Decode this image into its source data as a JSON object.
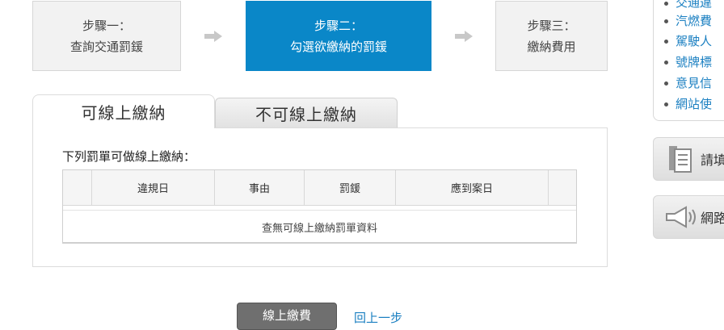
{
  "steps": [
    {
      "title": "步驟一：",
      "text": "查詢交通罰鍰",
      "active": false
    },
    {
      "title": "步驟二：",
      "text": "勾選欲繳納的罰鍰",
      "active": true
    },
    {
      "title": "步驟三：",
      "text": "繳納費用",
      "active": false
    }
  ],
  "tabs": {
    "online": "可線上繳納",
    "offline": "不可線上繳納"
  },
  "table": {
    "title": "下列罰單可做線上繳納：",
    "headers": [
      "",
      "違規日",
      "事由",
      "罰鍰",
      "應到案日",
      ""
    ],
    "empty_message": "查無可線上繳納罰單資料"
  },
  "actions": {
    "pay_label": "線上繳費",
    "back_label": "回上一步"
  },
  "sidebar": {
    "links": [
      "交通違",
      "汽燃費",
      "駕駛人",
      "號牌標",
      "意見信",
      "網站使"
    ],
    "buttons": [
      {
        "label": "請填",
        "icon": "document-icon"
      },
      {
        "label": "網路",
        "icon": "megaphone-icon"
      }
    ]
  },
  "colors": {
    "accent": "#0a87c8",
    "link": "#1a7fc1"
  }
}
